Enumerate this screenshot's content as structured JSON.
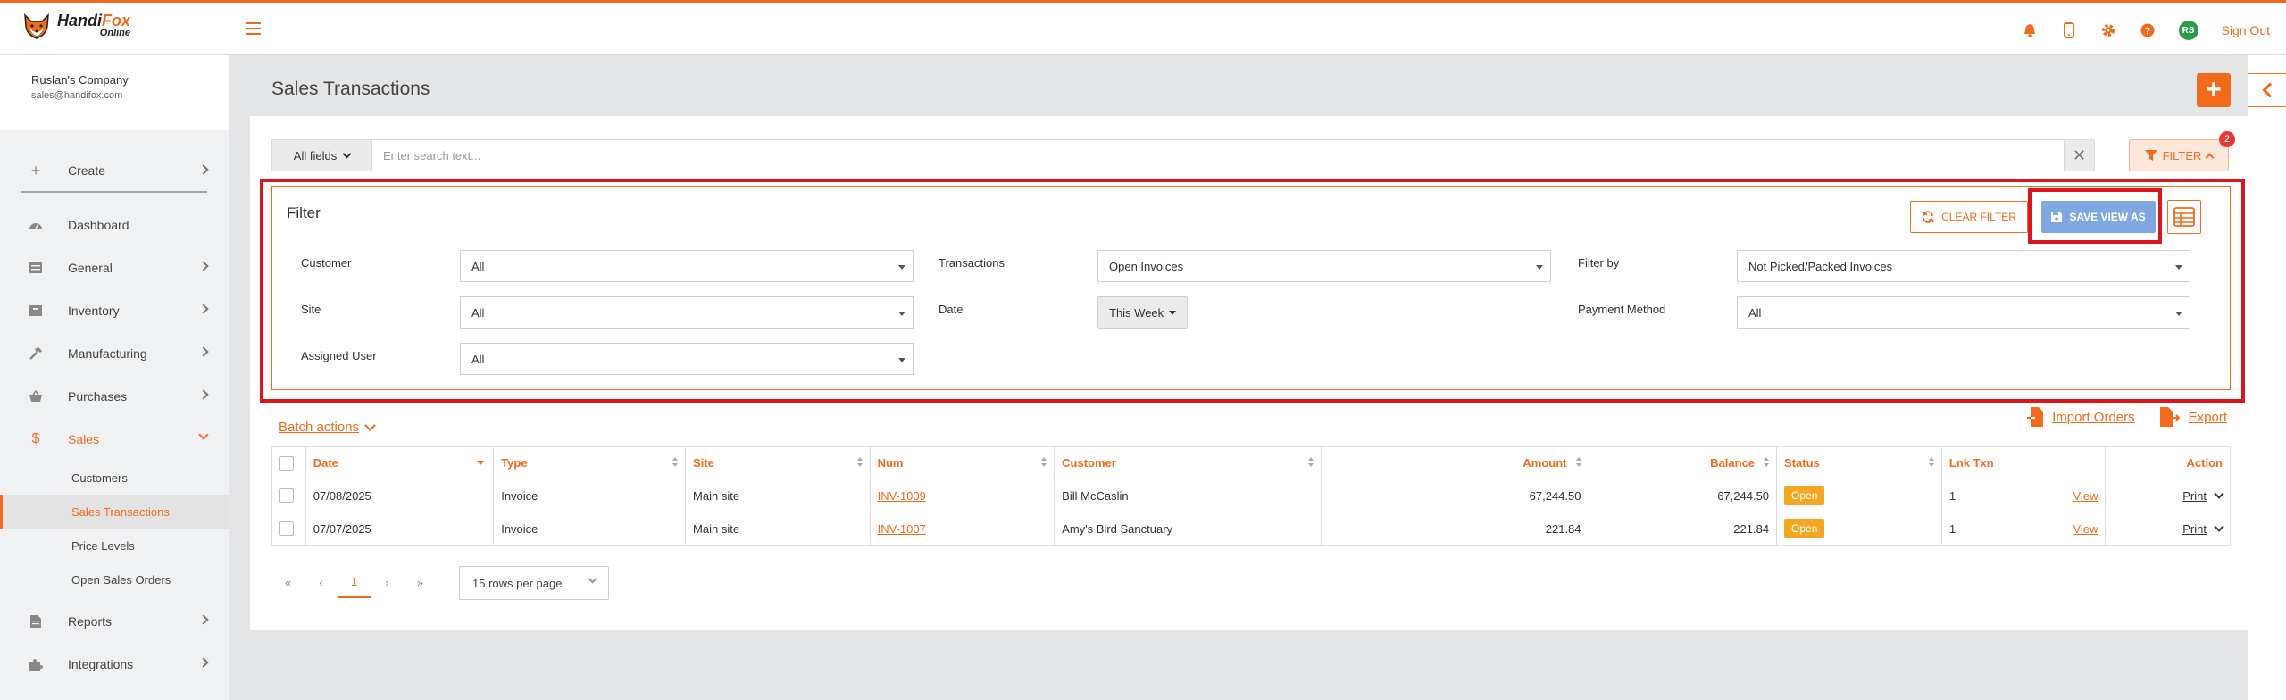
{
  "brand": {
    "name_a": "Handi",
    "name_b": "Fox",
    "sub": "Online"
  },
  "topbar": {
    "signout": "Sign Out",
    "avatar_initials": "RS"
  },
  "company": {
    "name": "Ruslan's Company",
    "email": "sales@handifox.com"
  },
  "sidebar": {
    "create": "Create",
    "items": [
      {
        "label": "Dashboard"
      },
      {
        "label": "General"
      },
      {
        "label": "Inventory"
      },
      {
        "label": "Manufacturing"
      },
      {
        "label": "Purchases"
      },
      {
        "label": "Sales"
      }
    ],
    "sales_sub": [
      "Customers",
      "Sales Transactions",
      "Price Levels",
      "Open Sales Orders"
    ],
    "more": [
      {
        "label": "Reports"
      },
      {
        "label": "Integrations"
      }
    ]
  },
  "page": {
    "title": "Sales Transactions",
    "add": "+"
  },
  "search": {
    "fields_label": "All fields",
    "placeholder": "Enter search text...",
    "clear": "✕"
  },
  "filter_toggle": {
    "label": "FILTER",
    "badge": "2"
  },
  "filter": {
    "title": "Filter",
    "clear_label": "CLEAR FILTER",
    "save_label": "SAVE VIEW AS",
    "customer": {
      "label": "Customer",
      "value": "All"
    },
    "site": {
      "label": "Site",
      "value": "All"
    },
    "assigned": {
      "label": "Assigned User",
      "value": "All"
    },
    "transactions": {
      "label": "Transactions",
      "value": "Open Invoices"
    },
    "date": {
      "label": "Date",
      "value": "This Week"
    },
    "filter_by": {
      "label": "Filter by",
      "value": "Not Picked/Packed Invoices"
    },
    "payment": {
      "label": "Payment Method",
      "value": "All"
    }
  },
  "batch": {
    "label": "Batch actions"
  },
  "import": {
    "label": "Import Orders"
  },
  "export": {
    "label": "Export"
  },
  "table": {
    "headers": {
      "date": "Date",
      "type": "Type",
      "site": "Site",
      "num": "Num",
      "customer": "Customer",
      "amount": "Amount",
      "balance": "Balance",
      "status": "Status",
      "lnk": "Lnk Txn",
      "action": "Action"
    },
    "rows": [
      {
        "date": "07/08/2025",
        "type": "Invoice",
        "site": "Main site",
        "num": "INV-1009",
        "customer": "Bill McCaslin",
        "amount": "67,244.50",
        "balance": "67,244.50",
        "status": "Open",
        "lnk": "1",
        "view": "View",
        "print": "Print"
      },
      {
        "date": "07/07/2025",
        "type": "Invoice",
        "site": "Main site",
        "num": "INV-1007",
        "customer": "Amy's Bird Sanctuary",
        "amount": "221.84",
        "balance": "221.84",
        "status": "Open",
        "lnk": "1",
        "view": "View",
        "print": "Print"
      }
    ]
  },
  "pager": {
    "first": "«",
    "prev": "‹",
    "current": "1",
    "next": "›",
    "last": "»",
    "rows_per_page": "15 rows per page"
  },
  "colors": {
    "accent": "#f26b1d",
    "highlight": "#e0141e",
    "save": "#7fa7e0",
    "status_open": "#f5a623"
  }
}
